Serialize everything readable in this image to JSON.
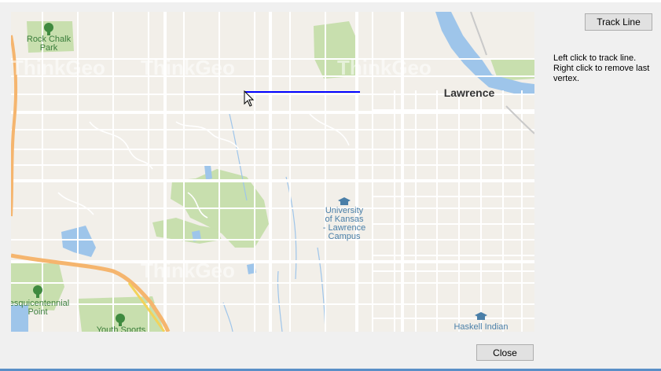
{
  "toolbar": {
    "track_line_label": "Track Line",
    "close_label": "Close"
  },
  "instructions": {
    "line1": "Left click to track line.",
    "line2": "Right click to remove last",
    "line3": "vertex."
  },
  "map": {
    "labels": {
      "rock_chalk_1": "Rock Chalk",
      "rock_chalk_2": "Park",
      "lawrence": "Lawrence",
      "ku_1": "University",
      "ku_2": "of Kansas",
      "ku_3": "- Lawrence",
      "ku_4": "Campus",
      "sesqui_1": "esquicentennial",
      "sesqui_2": "Point",
      "youth_sports": "Youth Sports",
      "haskell": "Haskell Indian"
    },
    "watermarks": [
      "ThinkGeo",
      "ThinkGeo",
      "ThinkGeo",
      "ThinkGeo"
    ],
    "colors": {
      "land": "#f2efe9",
      "park": "#c6ddaa",
      "water": "#9ec3e8",
      "road": "#ffffff",
      "highway": "#f5b56e",
      "tracked_line": "#0000ff",
      "label_green": "#3a7d3a",
      "label_blue": "#4a7fa8"
    }
  }
}
